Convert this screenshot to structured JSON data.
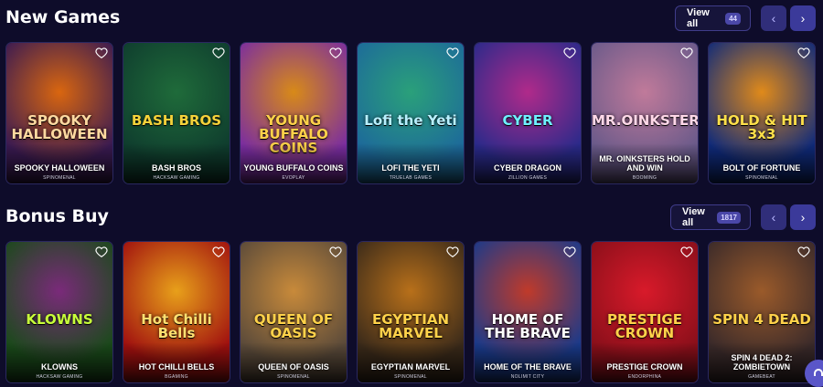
{
  "new_games": {
    "title": "New Games",
    "view_all_label": "View all",
    "count": "44",
    "prev_icon": "‹",
    "next_icon": "›",
    "cards": [
      {
        "name": "SPOOKY HALLOWEEN",
        "provider": "SPINOMENAL",
        "art_text": "SPOOKY HALLOWEEN",
        "bg": [
          "#3a1a52",
          "#d9660f"
        ],
        "text_color": "#ffd9a0"
      },
      {
        "name": "BASH BROS",
        "provider": "HACKSAW GAMING",
        "art_text": "BASH BROS",
        "bg": [
          "#0f3d2e",
          "#1f6b3a"
        ],
        "text_color": "#f5d23a"
      },
      {
        "name": "YOUNG BUFFALO COINS",
        "provider": "EVOPLAY",
        "art_text": "YOUNG BUFFALO COINS",
        "bg": [
          "#7a2da0",
          "#d88a18"
        ],
        "text_color": "#ffd24a"
      },
      {
        "name": "LOFI THE YETI",
        "provider": "TRUELAB GAMES",
        "art_text": "Lofi the Yeti",
        "bg": [
          "#1d6a9a",
          "#2aa07a"
        ],
        "text_color": "#b8f0ff"
      },
      {
        "name": "CYBER DRAGON",
        "provider": "ZILLION GAMES",
        "art_text": "CYBER",
        "bg": [
          "#2a2a8a",
          "#b02a8a"
        ],
        "text_color": "#6ef0ff"
      },
      {
        "name": "MR. OINKSTERS HOLD AND WIN",
        "provider": "BOOMING",
        "art_text": "MR.OINKSTERS",
        "bg": [
          "#6a5a8a",
          "#c07a9a"
        ],
        "text_color": "#ffd8e8"
      },
      {
        "name": "BOLT OF FORTUNE",
        "provider": "SPINOMENAL",
        "art_text": "HOLD & HIT 3x3",
        "bg": [
          "#0f2a7a",
          "#e08a1a"
        ],
        "text_color": "#ffe04a"
      }
    ]
  },
  "bonus_buy": {
    "title": "Bonus Buy",
    "view_all_label": "View all",
    "count": "1817",
    "prev_icon": "‹",
    "next_icon": "›",
    "cards": [
      {
        "name": "KLOWNS",
        "provider": "HACKSAW GAMING",
        "art_text": "KLOWNS",
        "bg": [
          "#1a4a1a",
          "#7a2a7a"
        ],
        "text_color": "#c8ff3a"
      },
      {
        "name": "HOT CHILLI BELLS",
        "provider": "BGAMING",
        "art_text": "Hot Chilli Bells",
        "bg": [
          "#a0100f",
          "#e8a01a"
        ],
        "text_color": "#ffe070"
      },
      {
        "name": "QUEEN OF OASIS",
        "provider": "SPINOMENAL",
        "art_text": "QUEEN OF OASIS",
        "bg": [
          "#5a4a3a",
          "#c88a3a"
        ],
        "text_color": "#ffd24a"
      },
      {
        "name": "EGYPTIAN MARVEL",
        "provider": "SPINOMENAL",
        "art_text": "EGYPTIAN MARVEL",
        "bg": [
          "#3a2a1a",
          "#b8701a"
        ],
        "text_color": "#ffd24a"
      },
      {
        "name": "HOME OF THE BRAVE",
        "provider": "NOLIMIT CITY",
        "art_text": "HOME OF THE BRAVE",
        "bg": [
          "#1a3a8a",
          "#c03a2a"
        ],
        "text_color": "#ffffff"
      },
      {
        "name": "PRESTIGE CROWN",
        "provider": "ENDORPHINA",
        "art_text": "PRESTIGE CROWN",
        "bg": [
          "#8a0f1a",
          "#d81a2a"
        ],
        "text_color": "#ffd24a"
      },
      {
        "name": "SPIN 4 DEAD 2: ZOMBIETOWN",
        "provider": "GAMEBEAT",
        "art_text": "SPIN 4 DEAD",
        "bg": [
          "#3a2a2a",
          "#9a5a2a"
        ],
        "text_color": "#ffd24a"
      }
    ]
  },
  "support_icon": "chat-support"
}
